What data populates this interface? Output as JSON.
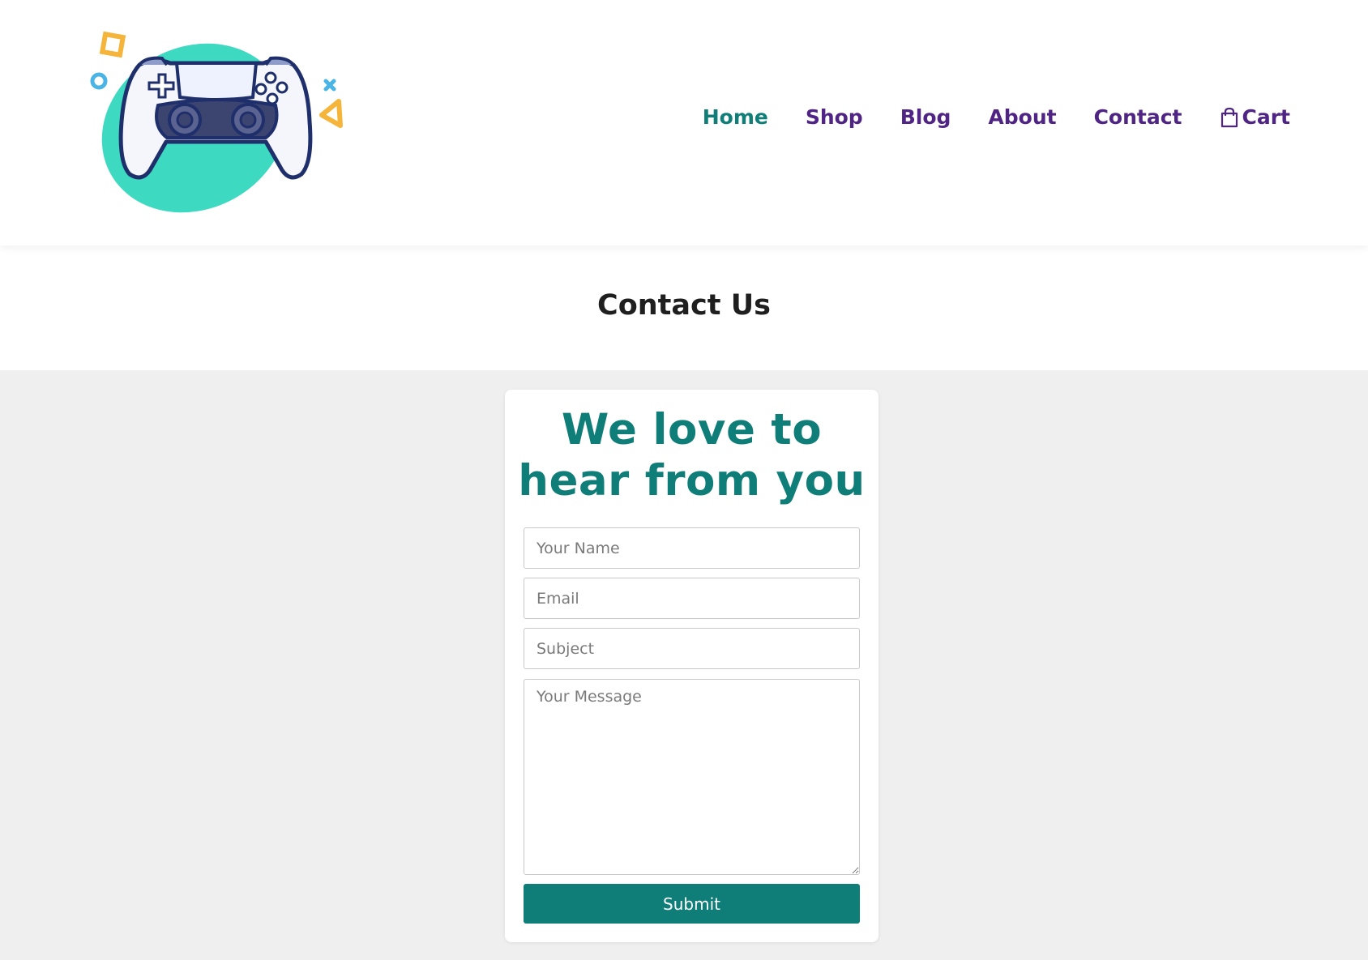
{
  "nav": {
    "items": [
      {
        "label": "Home",
        "active": true
      },
      {
        "label": "Shop"
      },
      {
        "label": "Blog"
      },
      {
        "label": "About"
      },
      {
        "label": "Contact"
      }
    ],
    "cart_label": "Cart",
    "cart_icon": "shopping-bag-icon"
  },
  "logo": {
    "icon": "game-controller-logo"
  },
  "page": {
    "title": "Contact Us"
  },
  "form": {
    "heading_line1": "We love to",
    "heading_line2": "hear from you",
    "name_placeholder": "Your Name",
    "email_placeholder": "Email",
    "subject_placeholder": "Subject",
    "message_placeholder": "Your Message",
    "submit_label": "Submit"
  },
  "colors": {
    "accent": "#107e78",
    "nav": "#4f2485",
    "logo_blob": "#3dd9c1",
    "controller_outline": "#1f2f6b",
    "background": "#efefef"
  }
}
